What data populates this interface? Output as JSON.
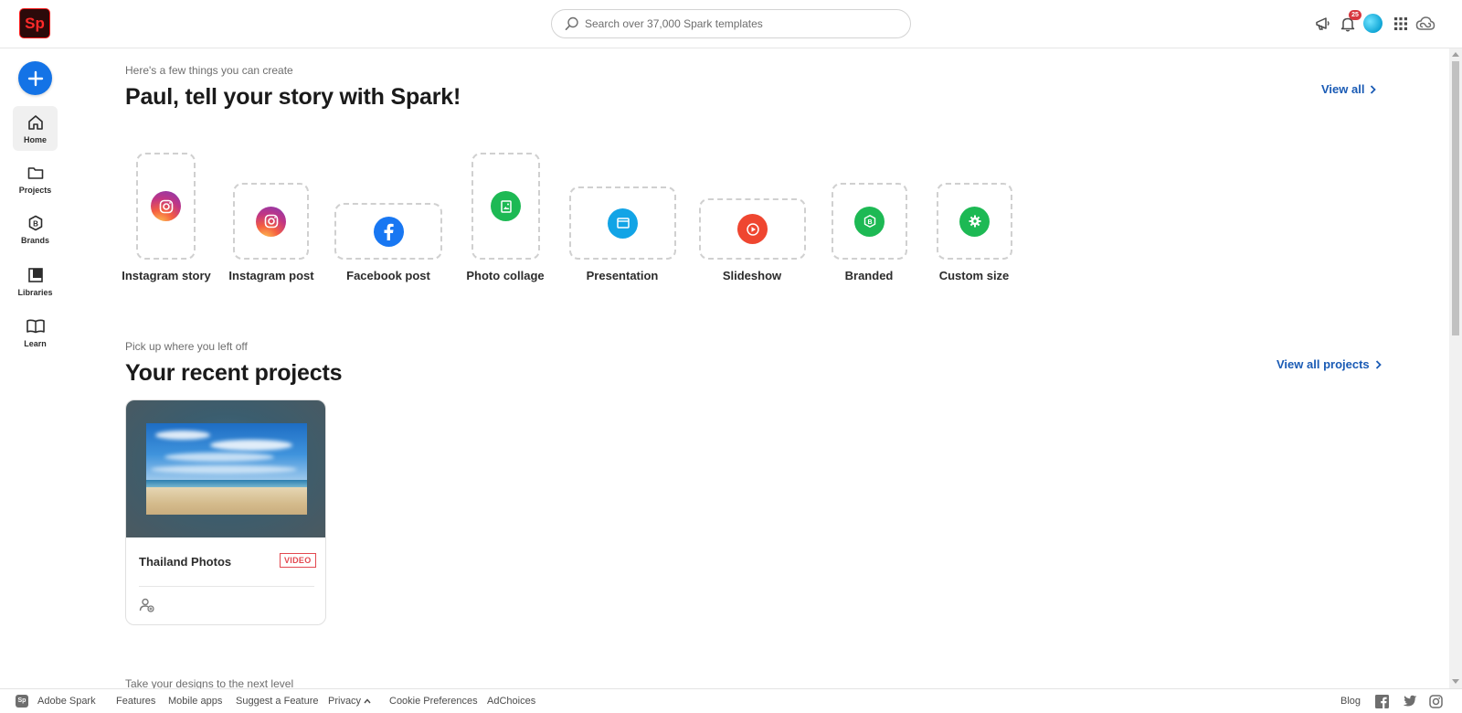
{
  "app": {
    "logo_text": "Sp",
    "brand_color": "#ff0000",
    "accent_color": "#1473e6"
  },
  "search": {
    "placeholder": "Search over 37,000 Spark templates"
  },
  "header_icons": [
    "megaphone-icon",
    "bell-icon",
    "avatar",
    "apps-grid-icon",
    "creative-cloud-icon"
  ],
  "notifications": {
    "count": "25"
  },
  "sidebar": {
    "create_icon": "plus-icon",
    "items": [
      {
        "label": "Home",
        "icon": "home-icon",
        "active": true
      },
      {
        "label": "Projects",
        "icon": "folder-icon"
      },
      {
        "label": "Brands",
        "icon": "brand-icon"
      },
      {
        "label": "Libraries",
        "icon": "libraries-icon"
      },
      {
        "label": "Learn",
        "icon": "book-icon"
      }
    ]
  },
  "create_section": {
    "eyebrow": "Here's a few things you can create",
    "title": "Paul, tell your story with Spark!",
    "view_all": "View all",
    "formats": [
      {
        "label": "Instagram story",
        "icon": "instagram-icon"
      },
      {
        "label": "Instagram post",
        "icon": "instagram-icon"
      },
      {
        "label": "Facebook post",
        "icon": "facebook-icon",
        "color": "#1877f2"
      },
      {
        "label": "Photo collage",
        "icon": "photo-collage-icon",
        "color": "#1db954"
      },
      {
        "label": "Presentation",
        "icon": "presentation-icon",
        "color": "#12a4e6"
      },
      {
        "label": "Slideshow",
        "icon": "slideshow-icon",
        "color": "#ef4630"
      },
      {
        "label": "Branded",
        "icon": "branded-icon",
        "color": "#1db954"
      },
      {
        "label": "Custom size",
        "icon": "gear-icon",
        "color": "#1db954"
      }
    ]
  },
  "recent_section": {
    "eyebrow": "Pick up where you left off",
    "title": "Your recent projects",
    "view_all": "View all projects",
    "projects": [
      {
        "title": "Thailand Photos",
        "type": "VIDEO"
      }
    ]
  },
  "next_section": {
    "eyebrow": "Take your designs to the next level"
  },
  "footer": {
    "brand": "Adobe Spark",
    "links": [
      "Features",
      "Mobile apps",
      "Suggest a Feature",
      "Privacy",
      "Cookie Preferences",
      "AdChoices"
    ],
    "blog": "Blog",
    "social": [
      "facebook-icon",
      "twitter-icon",
      "instagram-icon"
    ]
  }
}
